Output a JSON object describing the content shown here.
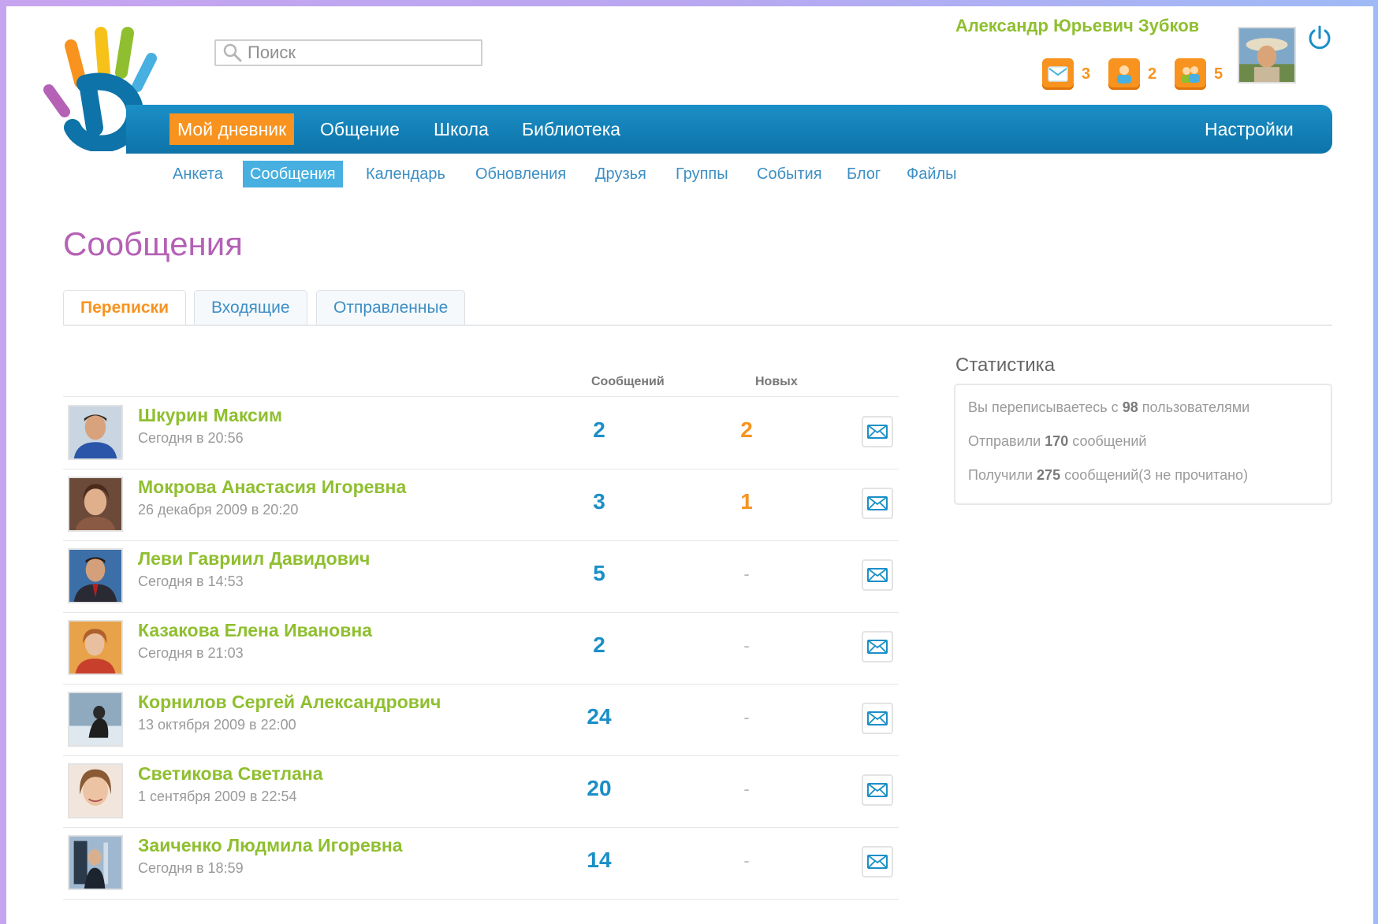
{
  "header": {
    "search_placeholder": "Поиск",
    "user_name": "Александр Юрьевич Зубков",
    "notifications": [
      {
        "icon": "mail-icon",
        "count": "3"
      },
      {
        "icon": "person-icon",
        "count": "2"
      },
      {
        "icon": "friends-icon",
        "count": "5"
      }
    ]
  },
  "nav": {
    "items": [
      "Мой дневник",
      "Общение",
      "Школа",
      "Библиотека"
    ],
    "settings": "Настройки"
  },
  "subnav": {
    "items": [
      "Анкета",
      "Сообщения",
      "Календарь",
      "Обновления",
      "Друзья",
      "Группы",
      "События",
      "Блог",
      "Файлы"
    ]
  },
  "page": {
    "title": "Сообщения",
    "tabs": [
      "Переписки",
      "Входящие",
      "Отправленные"
    ]
  },
  "table": {
    "columns": {
      "messages": "Сообщений",
      "new": "Новых"
    },
    "rows": [
      {
        "name": "Шкурин Максим",
        "date": "Сегодня в 20:56",
        "messages": "2",
        "new": "2"
      },
      {
        "name": "Мокрова Анастасия Игоревна",
        "date": "26 декабря 2009 в 20:20",
        "messages": "3",
        "new": "1"
      },
      {
        "name": "Леви Гавриил Давидович",
        "date": "Сегодня в 14:53",
        "messages": "5",
        "new": "-"
      },
      {
        "name": "Казакова Елена Ивановна",
        "date": "Сегодня в 21:03",
        "messages": "2",
        "new": "-"
      },
      {
        "name": "Корнилов Сергей Александрович",
        "date": "13 октября 2009 в 22:00",
        "messages": "24",
        "new": "-"
      },
      {
        "name": "Светикова Светлана",
        "date": "1 сентября 2009 в 22:54",
        "messages": "20",
        "new": "-"
      },
      {
        "name": "Заиченко Людмила Игоревна",
        "date": "Сегодня в 18:59",
        "messages": "14",
        "new": "-"
      }
    ]
  },
  "stats": {
    "title": "Статистика",
    "line1": {
      "pre": "Вы переписываетесь с ",
      "num": "98",
      "post": " пользователями"
    },
    "line2": {
      "pre": "Отправили ",
      "num": "170",
      "post": " сообщений"
    },
    "line3": {
      "pre": "Получили ",
      "num": "275",
      "post": " сообщений(3 не прочитано)"
    }
  },
  "colors": {
    "accent_orange": "#f7931e",
    "nav_blue": "#0d73a8",
    "link_blue": "#3d8fc4",
    "name_green": "#8fbf2f",
    "title_purple": "#b561b6"
  }
}
